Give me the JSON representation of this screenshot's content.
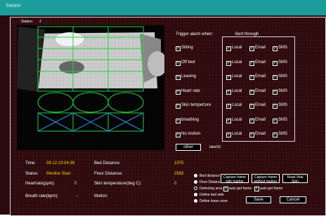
{
  "window": {
    "title": "Station"
  },
  "station": {
    "label": "Station:",
    "value": "2"
  },
  "alarm": {
    "trigger_heading": "Trigger alarm when:",
    "alert_heading": "Alert through",
    "conditions": [
      {
        "label": "Sitting",
        "checked": true,
        "local": true,
        "email": true,
        "sms": true
      },
      {
        "label": "Off bed",
        "checked": true,
        "local": true,
        "email": true,
        "sms": true
      },
      {
        "label": "Leaving",
        "checked": true,
        "local": true,
        "email": true,
        "sms": true
      },
      {
        "label": "Heart rate",
        "checked": true,
        "local": true,
        "email": true,
        "sms": true
      },
      {
        "label": "Skin temperture",
        "checked": true,
        "local": true,
        "email": true,
        "sms": true
      },
      {
        "label": "breathing",
        "checked": true,
        "local": true,
        "email": true,
        "sms": true
      },
      {
        "label": "No motion",
        "checked": true,
        "local": true,
        "email": true,
        "sms": true
      }
    ],
    "channel_labels": {
      "local": "Local",
      "email": "Email",
      "sms": "SMS"
    }
  },
  "other_button": "other",
  "label10": "label10",
  "readings": {
    "time_label": "Time:",
    "time_value": "08:12:13:04:39",
    "bed_distance_label": "Bed Distance:",
    "bed_distance_value": "1975",
    "status_label": "Status:",
    "status_value": "Monitor Start",
    "floor_distance_label": "Floor Distance:",
    "floor_distance_value": "2565",
    "heartrate_label": "Heartrate(ppm):",
    "heartrate_value": "0",
    "skin_temp_label": "Skin temperature(deg C):",
    "skin_temp_value": "0",
    "breath_label": "Breath rate(bpm):",
    "breath_value": "--",
    "motion_label": "Motion:"
  },
  "radios": [
    {
      "label": "Bed distance",
      "selected": false
    },
    {
      "label": "Floor Distance",
      "selected": false
    },
    {
      "label": "Detecting area",
      "selected": true
    },
    {
      "label": "Define bed side",
      "selected": false
    },
    {
      "label": "Define leave zone",
      "selected": false
    }
  ],
  "buttons": {
    "capture_with_marker": "Capture frame with marker",
    "capture_without_marker": "Capture frame without marker",
    "read_vital_sign": "Read Vital Sign",
    "auto_get_frame_1": "auto get frame",
    "auto_get_frame_2": "auto get frame",
    "save": "Save",
    "cancel": "Cancel"
  },
  "colors": {
    "background": "#2f0b0d",
    "value_text": "#ffd200",
    "grid": "#1fd43f",
    "cross": "#2a8fd6",
    "titlebar": "#1c9c9a"
  }
}
